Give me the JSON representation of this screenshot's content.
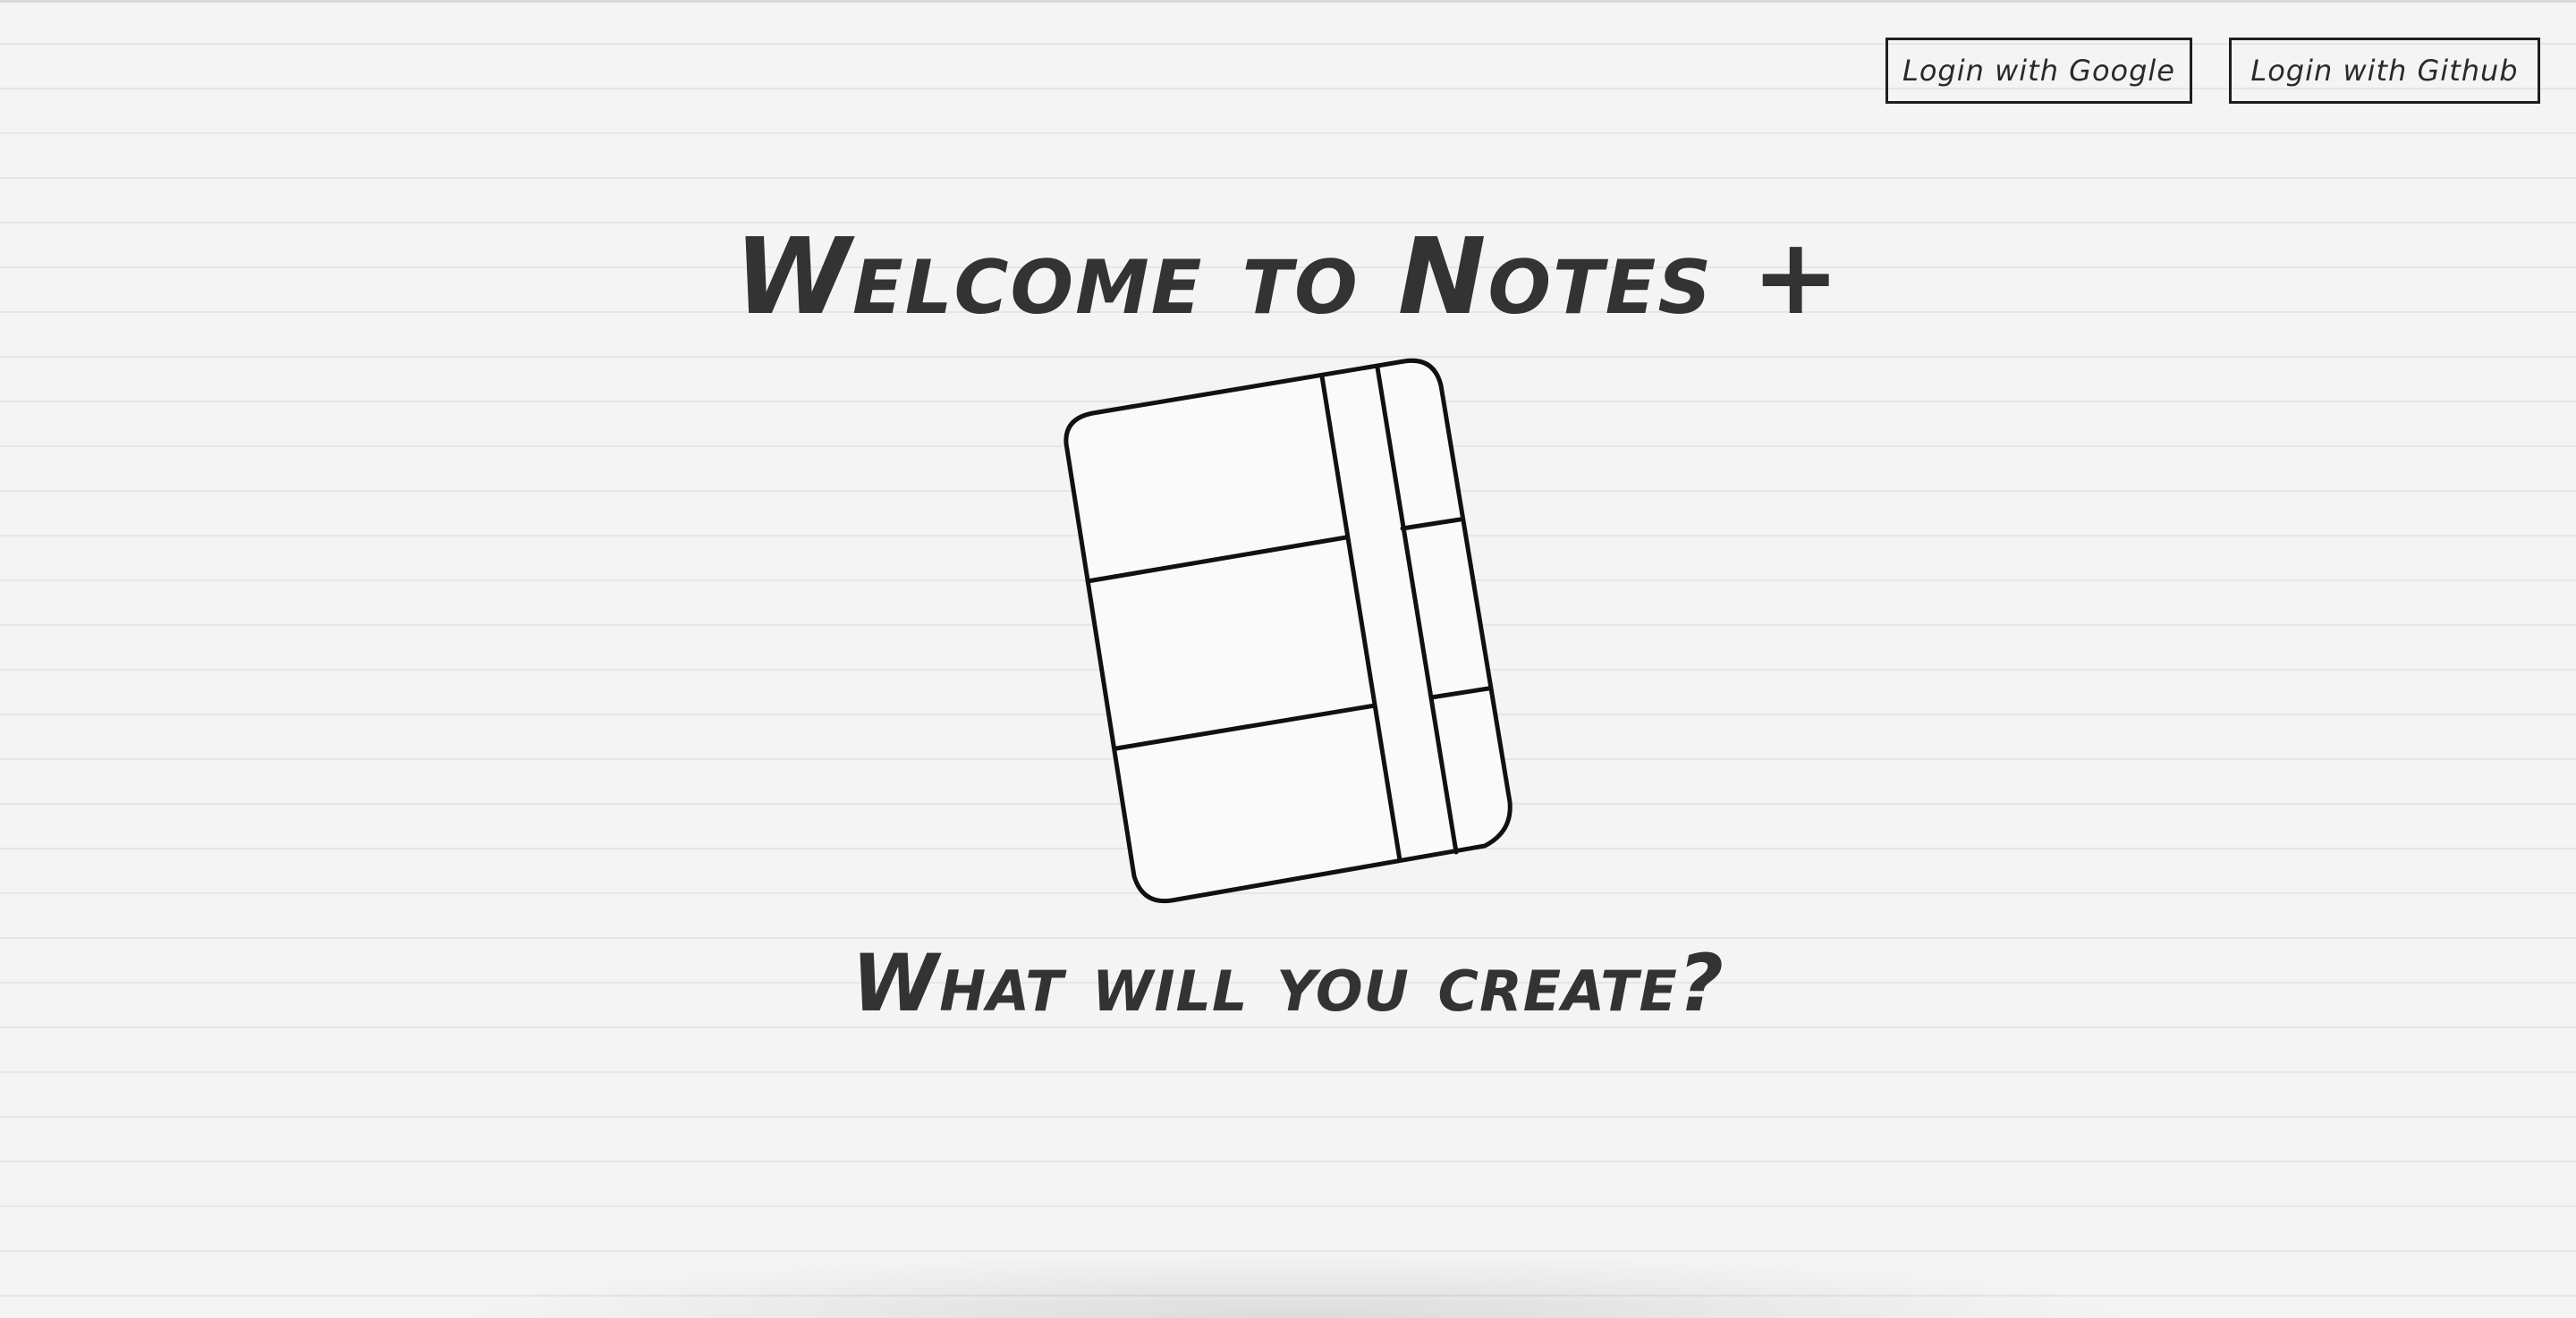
{
  "header": {
    "login_google_label": "Login with Google",
    "login_github_label": "Login with Github"
  },
  "main": {
    "title": "Welcome to Notes +",
    "tagline": "What will you create?",
    "illustration_icon": "notebook-icon"
  },
  "colors": {
    "background": "#f4f4f4",
    "rule_lines": "#e6e6e6",
    "text": "#333333",
    "outline": "#1e1e1e"
  }
}
